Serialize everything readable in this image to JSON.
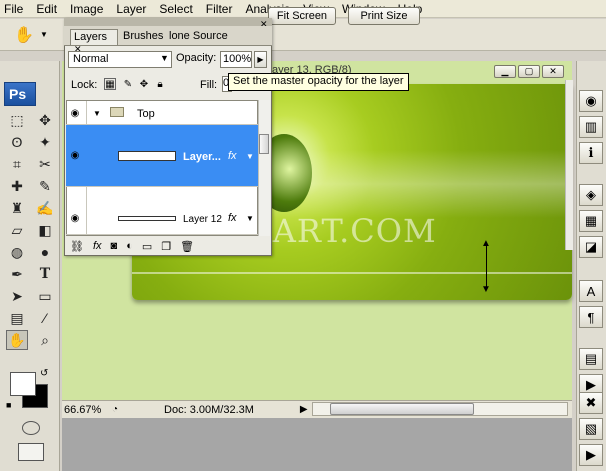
{
  "menu": [
    "File",
    "Edit",
    "Image",
    "Layer",
    "Select",
    "Filter",
    "Analysis",
    "View",
    "Window",
    "Help"
  ],
  "options_bar": {
    "fit_screen": "Fit Screen",
    "print_size": "Print Size"
  },
  "app_logo": "Ps",
  "document": {
    "title_fragment": "ayer 13, RGB/8)",
    "zoom": "66.67%",
    "doc_size": "Doc: 3.00M/32.3M",
    "watermark": "ALFOART.COM"
  },
  "layers_panel": {
    "tabs": [
      "Layers",
      "Brushes",
      "lone Source"
    ],
    "blend_mode": "Normal",
    "opacity_label": "Opacity:",
    "opacity_value": "100%",
    "lock_label": "Lock:",
    "fill_label": "Fill:",
    "fill_value": "0",
    "tooltip": "Set the master opacity for the layer",
    "layers": [
      {
        "name": "Top",
        "type": "group"
      },
      {
        "name": "Layer...",
        "type": "layer",
        "selected": true,
        "fx": true
      },
      {
        "name": "Layer 12",
        "type": "layer",
        "selected": false,
        "fx": true
      }
    ]
  },
  "colors": {
    "selection": "#3a8df3",
    "canvas_green": "#a7cc20",
    "background_green": "#d0e4a0"
  }
}
